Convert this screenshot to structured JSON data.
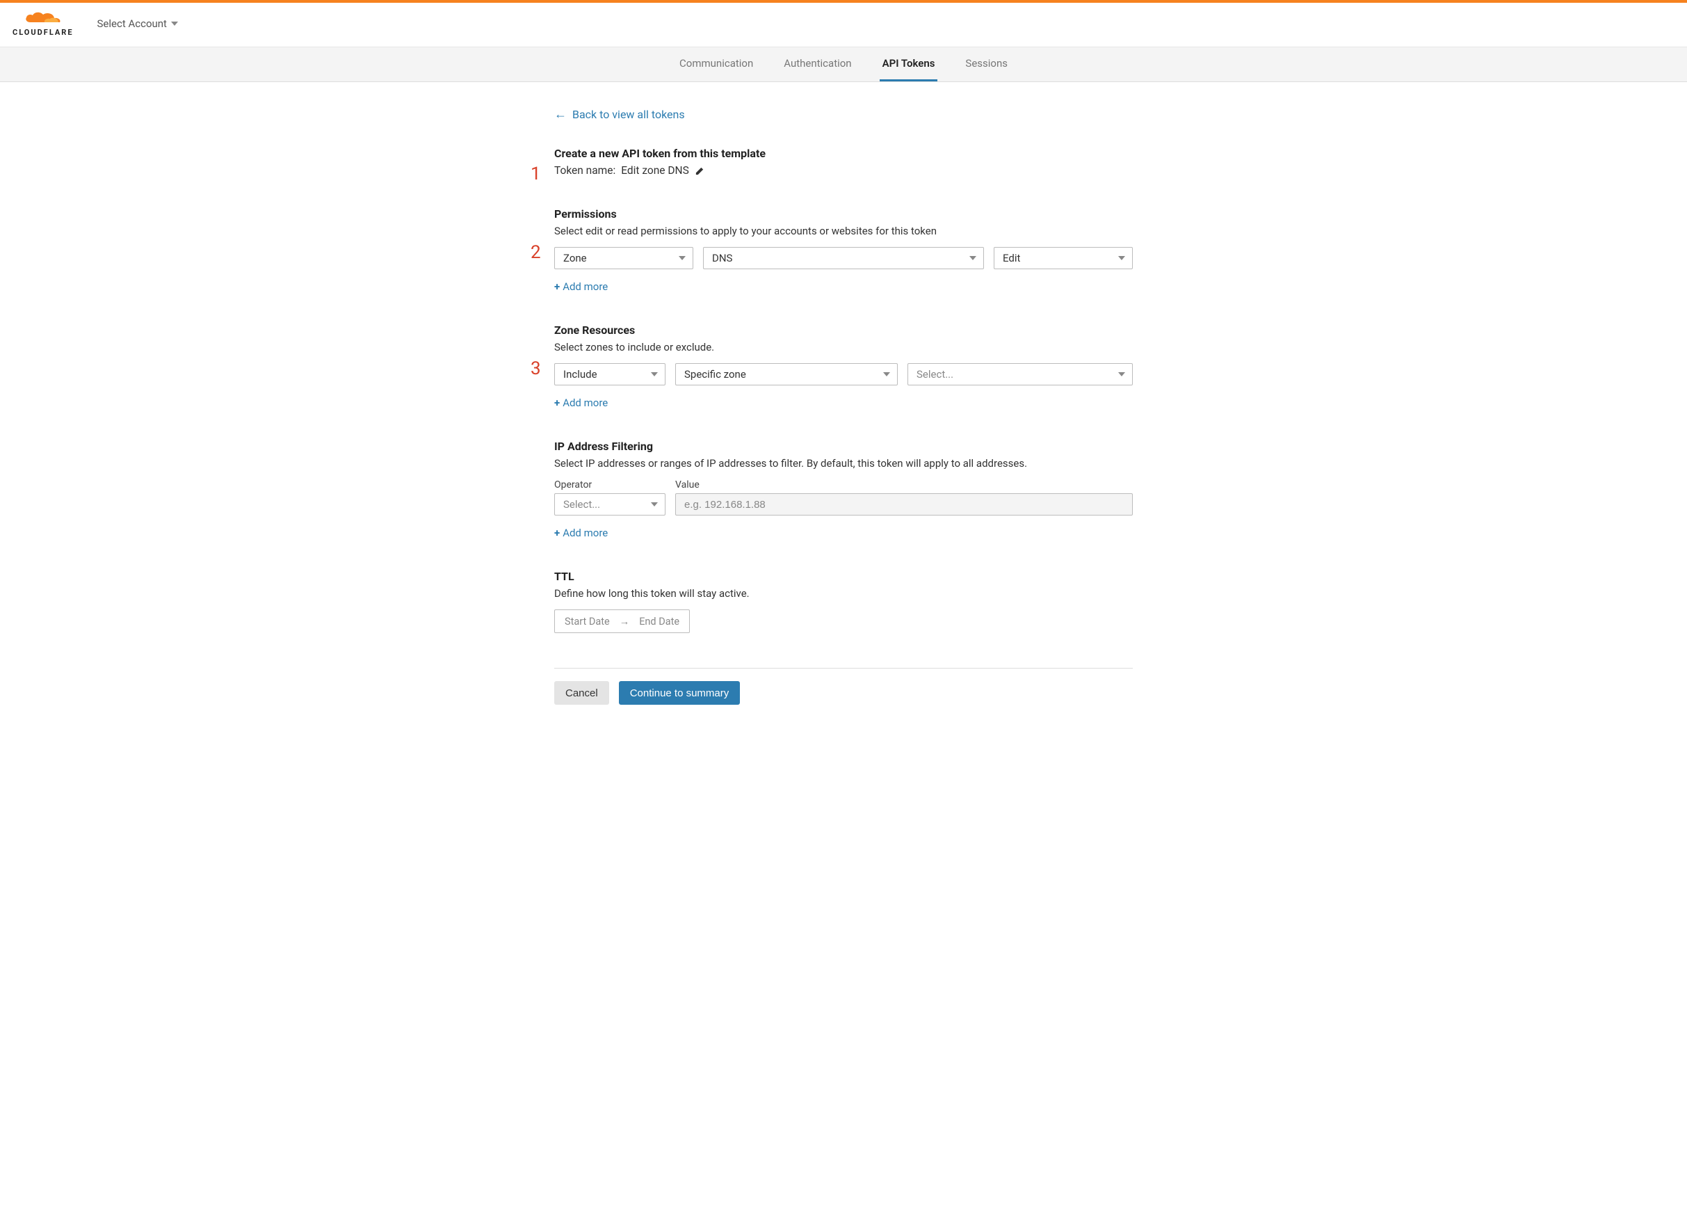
{
  "header": {
    "brand": "CLOUDFLARE",
    "account_selector": "Select Account"
  },
  "tabs": [
    {
      "label": "Communication",
      "active": false
    },
    {
      "label": "Authentication",
      "active": false
    },
    {
      "label": "API Tokens",
      "active": true
    },
    {
      "label": "Sessions",
      "active": false
    }
  ],
  "back_link": "Back to view all tokens",
  "create": {
    "title": "Create a new API token from this template",
    "token_name_label": "Token name:",
    "token_name_value": "Edit zone DNS"
  },
  "permissions": {
    "title": "Permissions",
    "desc": "Select edit or read permissions to apply to your accounts or websites for this token",
    "scope": "Zone",
    "resource": "DNS",
    "level": "Edit",
    "add_more": "Add more"
  },
  "zone_resources": {
    "title": "Zone Resources",
    "desc": "Select zones to include or exclude.",
    "mode": "Include",
    "scope": "Specific zone",
    "zone_placeholder": "Select...",
    "add_more": "Add more"
  },
  "ip_filter": {
    "title": "IP Address Filtering",
    "desc": "Select IP addresses or ranges of IP addresses to filter. By default, this token will apply to all addresses.",
    "operator_label": "Operator",
    "value_label": "Value",
    "operator_placeholder": "Select...",
    "value_placeholder": "e.g. 192.168.1.88",
    "add_more": "Add more"
  },
  "ttl": {
    "title": "TTL",
    "desc": "Define how long this token will stay active.",
    "start": "Start Date",
    "end": "End Date"
  },
  "actions": {
    "cancel": "Cancel",
    "continue": "Continue to summary"
  },
  "annotations": {
    "a1": "1",
    "a2": "2",
    "a3": "3"
  }
}
